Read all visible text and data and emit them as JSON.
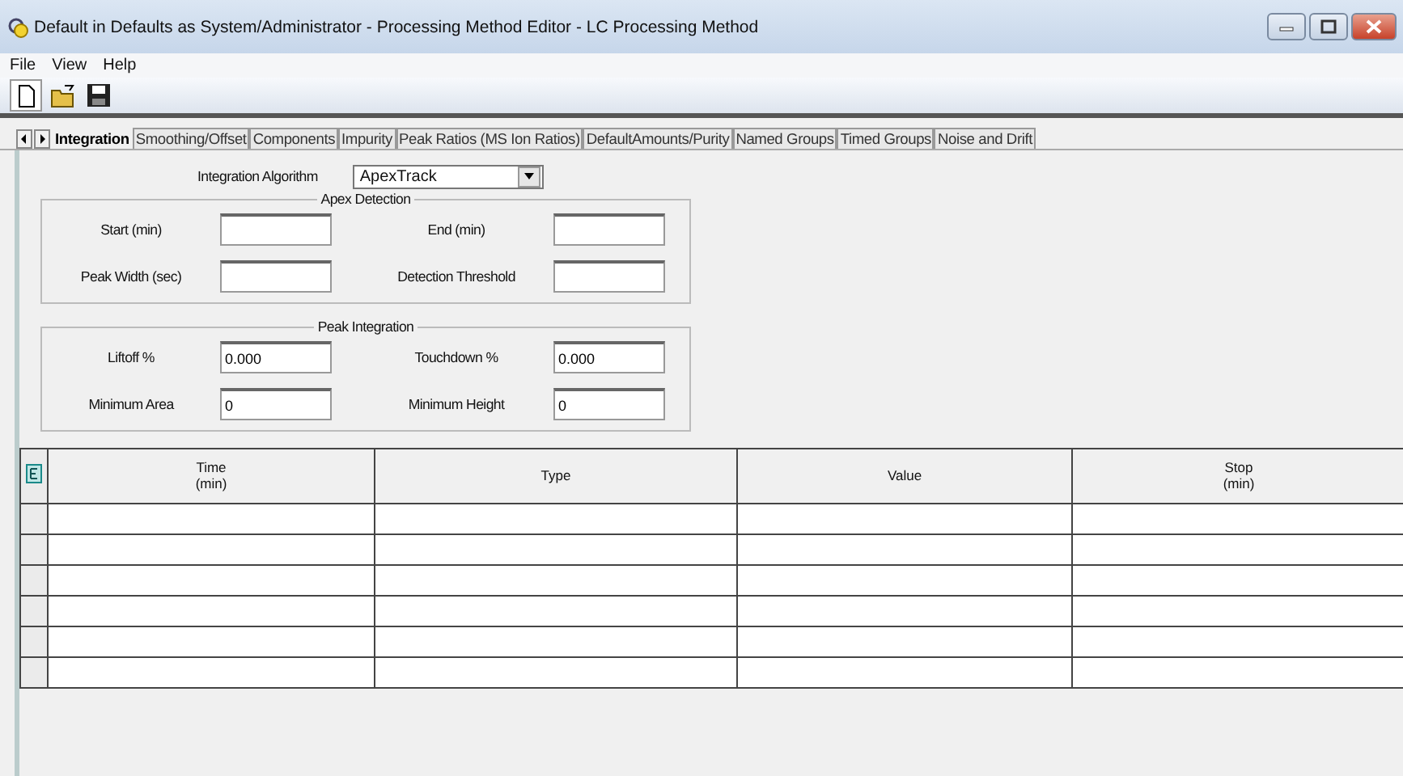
{
  "window": {
    "title": "Default in Defaults as System/Administrator - Processing Method Editor - LC Processing Method"
  },
  "menu": [
    "File",
    "View",
    "Help"
  ],
  "tabs": [
    {
      "label": "Integration",
      "selected": true
    },
    {
      "label": "Smoothing/Offset",
      "selected": false
    },
    {
      "label": "Components",
      "selected": false
    },
    {
      "label": "Impurity",
      "selected": false
    },
    {
      "label": "Peak Ratios (MS Ion Ratios)",
      "selected": false
    },
    {
      "label": "DefaultAmounts/Purity",
      "selected": false
    },
    {
      "label": "Named Groups",
      "selected": false
    },
    {
      "label": "Timed Groups",
      "selected": false
    },
    {
      "label": "Noise and Drift",
      "selected": false
    }
  ],
  "algorithm": {
    "label": "Integration Algorithm",
    "value": "ApexTrack"
  },
  "groups": [
    {
      "title": "Apex Detection",
      "fields": [
        {
          "label": "Start (min)"
        },
        {
          "label": "End (min)"
        },
        {
          "label": "Peak Width (sec)"
        },
        {
          "label": "Detection Threshold"
        }
      ]
    },
    {
      "title": "Peak Integration",
      "fields": [
        {
          "label": "Liftoff %",
          "value": "0.000"
        },
        {
          "label": "Touchdown %",
          "value": "0.000"
        },
        {
          "label": "Minimum Area",
          "value": "0"
        },
        {
          "label": "Minimum Height",
          "value": "0"
        }
      ]
    }
  ],
  "table": {
    "columns": [
      {
        "label": "Time\n(min)"
      },
      {
        "label": "Type"
      },
      {
        "label": "Value"
      },
      {
        "label": "Stop\n(min)"
      }
    ]
  }
}
